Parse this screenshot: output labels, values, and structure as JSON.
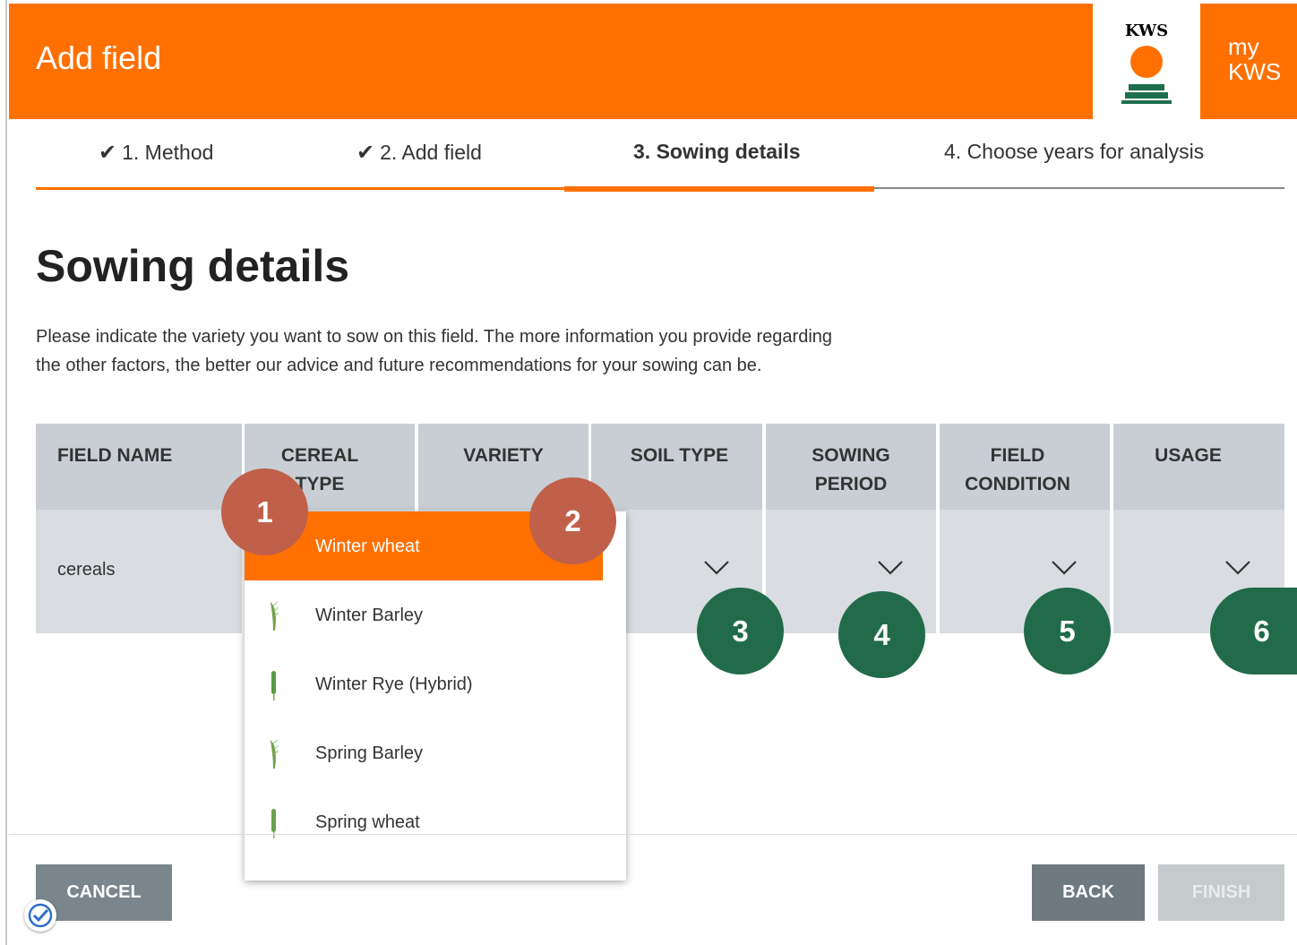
{
  "header": {
    "title": "Add field",
    "logo_text": "KWS",
    "brand_line1": "my",
    "brand_line2": "KWS",
    "accent_color": "#ff7000"
  },
  "steps": [
    {
      "label": "1. Method",
      "done": true
    },
    {
      "label": "2. Add field",
      "done": true
    },
    {
      "label": "3. Sowing details",
      "active": true
    },
    {
      "label": "4. Choose years for analysis"
    }
  ],
  "page": {
    "title": "Sowing details",
    "intro": "Please indicate the variety you want to sow on this field. The more information you provide regarding the other factors, the better our advice and future recommendations for your sowing can be."
  },
  "table": {
    "headers": [
      "FIELD NAME",
      "CEREAL TYPE",
      "VARIETY",
      "SOIL TYPE",
      "SOWING PERIOD",
      "FIELD CONDITION",
      "USAGE"
    ],
    "row": {
      "field_name": "cereals"
    }
  },
  "dropdown": {
    "selected": "Winter wheat",
    "options": [
      "Winter wheat",
      "Winter Barley",
      "Winter Rye (Hybrid)",
      "Spring Barley",
      "Spring wheat"
    ]
  },
  "annotations": [
    "1",
    "2",
    "3",
    "4",
    "5",
    "6"
  ],
  "footer": {
    "cancel": "CANCEL",
    "back": "BACK",
    "finish": "FINISH"
  }
}
